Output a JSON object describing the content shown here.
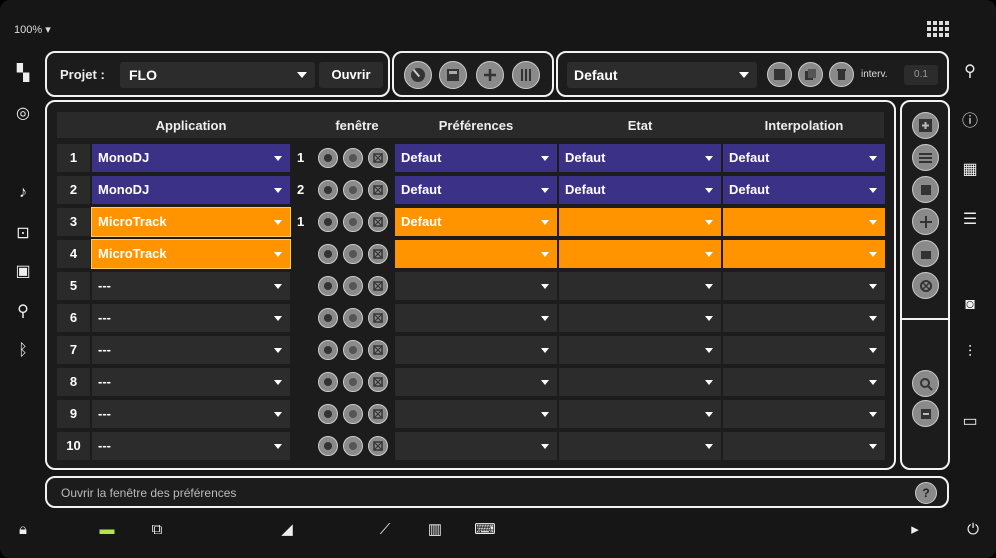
{
  "top": {
    "zoom": "100%"
  },
  "projet": {
    "label": "Projet :",
    "value": "FLO",
    "open_label": "Ouvrir"
  },
  "preset": {
    "value": "Defaut",
    "interv_label": "interv.",
    "interv_value": "0.1"
  },
  "table": {
    "headers": [
      "Application",
      "fenêtre",
      "Préférences",
      "Etat",
      "Interpolation"
    ],
    "rows": [
      {
        "num": "1",
        "app": "MonoDJ",
        "fen": "1",
        "pref": "Defaut",
        "etat": "Defaut",
        "interp": "Defaut",
        "style": "purple"
      },
      {
        "num": "2",
        "app": "MonoDJ",
        "fen": "2",
        "pref": "Defaut",
        "etat": "Defaut",
        "interp": "Defaut",
        "style": "purple"
      },
      {
        "num": "3",
        "app": "MicroTrack",
        "fen": "1",
        "pref": "Defaut",
        "etat": "",
        "interp": "",
        "style": "orange"
      },
      {
        "num": "4",
        "app": "MicroTrack",
        "fen": "",
        "pref": "",
        "etat": "",
        "interp": "",
        "style": "orange"
      },
      {
        "num": "5",
        "app": "---",
        "fen": "",
        "pref": "",
        "etat": "",
        "interp": "",
        "style": "dark"
      },
      {
        "num": "6",
        "app": "---",
        "fen": "",
        "pref": "",
        "etat": "",
        "interp": "",
        "style": "dark"
      },
      {
        "num": "7",
        "app": "---",
        "fen": "",
        "pref": "",
        "etat": "",
        "interp": "",
        "style": "dark"
      },
      {
        "num": "8",
        "app": "---",
        "fen": "",
        "pref": "",
        "etat": "",
        "interp": "",
        "style": "dark"
      },
      {
        "num": "9",
        "app": "---",
        "fen": "",
        "pref": "",
        "etat": "",
        "interp": "",
        "style": "dark"
      },
      {
        "num": "10",
        "app": "---",
        "fen": "",
        "pref": "",
        "etat": "",
        "interp": "",
        "style": "dark"
      }
    ]
  },
  "status": {
    "text": "Ouvrir la fenêtre des préférences",
    "help": "?"
  },
  "colors": {
    "purple": "#3b3288",
    "orange": "#ff9400",
    "border": "#f2f2f2",
    "panel": "#1c1c1c"
  }
}
